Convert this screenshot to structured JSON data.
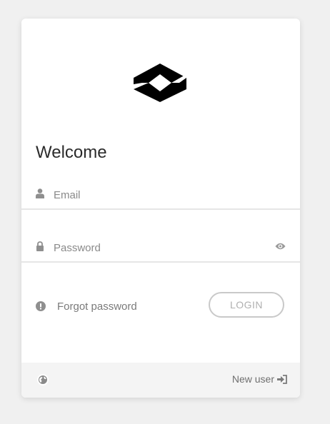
{
  "header": {
    "title": "Welcome"
  },
  "form": {
    "email": {
      "value": "",
      "placeholder": "Email",
      "icon": "user-icon"
    },
    "password": {
      "value": "",
      "placeholder": "Password",
      "icon": "lock-icon",
      "toggle_icon": "eye-icon"
    },
    "forgot_label": "Forgot password",
    "forgot_icon": "exclamation-circle-icon",
    "login_label": "LOGIN"
  },
  "footer": {
    "language_icon": "globe-icon",
    "new_user_label": "New user",
    "new_user_icon": "sign-in-icon"
  },
  "colors": {
    "background": "#f0f0f0",
    "card": "#ffffff",
    "footer": "#f4f4f4",
    "title": "#2b2b2b",
    "muted": "#8a8a8a",
    "button_border": "#c9c9c9"
  }
}
